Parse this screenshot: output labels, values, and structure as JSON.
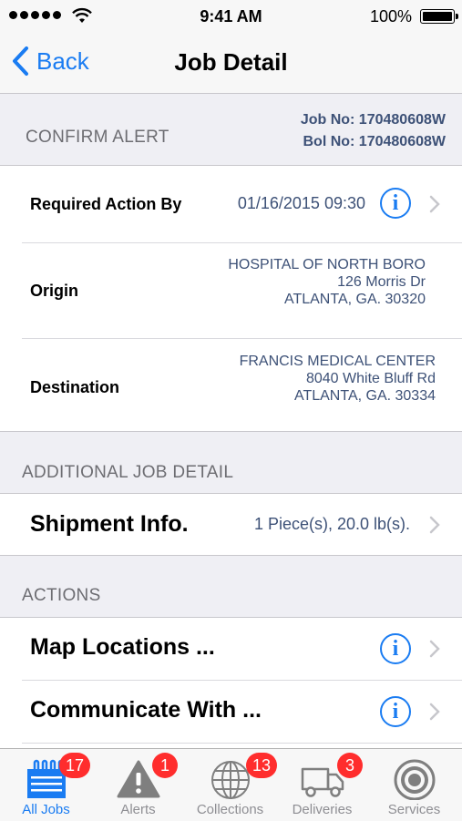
{
  "status_bar": {
    "time": "9:41 AM",
    "battery_pct": "100%"
  },
  "nav": {
    "back_label": "Back",
    "title": "Job Detail"
  },
  "confirm_alert": {
    "header": "CONFIRM ALERT",
    "job_no": "Job No: 170480608W",
    "bol_no": "Bol No: 170480608W"
  },
  "details": {
    "required_label": "Required Action By",
    "required_value": "01/16/2015 09:30",
    "origin_label": "Origin",
    "origin_lines": [
      "HOSPITAL OF NORTH BORO",
      "126 Morris Dr",
      "ATLANTA, GA. 30320"
    ],
    "destination_label": "Destination",
    "destination_lines": [
      "FRANCIS MEDICAL CENTER",
      "8040 White Bluff Rd",
      "ATLANTA, GA. 30334"
    ]
  },
  "additional": {
    "header": "ADDITIONAL JOB DETAIL",
    "shipment_label": "Shipment Info.",
    "shipment_value": "1 Piece(s), 20.0 lb(s)."
  },
  "actions": {
    "header": "ACTIONS",
    "items": [
      {
        "label": "Map Locations ..."
      },
      {
        "label": "Communicate With ..."
      }
    ]
  },
  "tabs": [
    {
      "label": "All Jobs",
      "badge": "17",
      "icon": "list-icon",
      "active": true
    },
    {
      "label": "Alerts",
      "badge": "1",
      "icon": "alert-triangle-icon",
      "active": false
    },
    {
      "label": "Collections",
      "badge": "13",
      "icon": "globe-icon",
      "active": false
    },
    {
      "label": "Deliveries",
      "badge": "3",
      "icon": "truck-icon",
      "active": false
    },
    {
      "label": "Services",
      "badge": "",
      "icon": "target-icon",
      "active": false
    }
  ],
  "colors": {
    "accent": "#1a7cf2",
    "value_text": "#3d5177",
    "badge": "#ff2d2d",
    "section_bg": "#efeff4"
  }
}
